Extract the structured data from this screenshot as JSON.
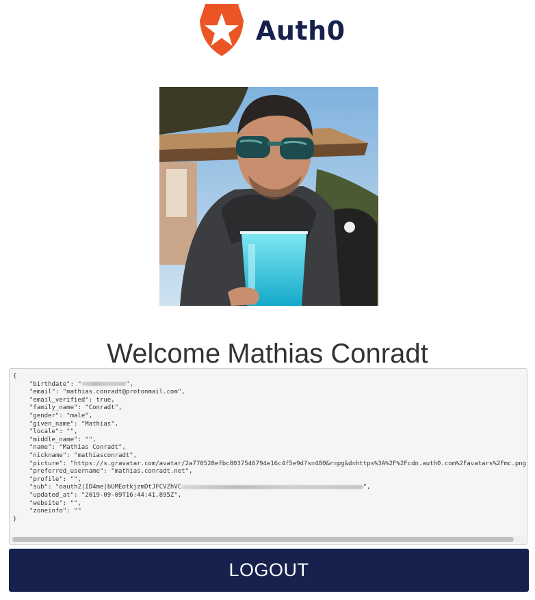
{
  "brand": {
    "name": "Auth0",
    "accent_color": "#eb5424",
    "text_color": "#16214d",
    "logo_icon": "auth0-shield-star-icon"
  },
  "avatar": {
    "alt": "Profile picture of Mathias Conradt"
  },
  "welcome": {
    "greeting": "Welcome",
    "name": "Mathias Conradt"
  },
  "profile_json": {
    "open_brace": "{",
    "close_brace": "}",
    "fields": [
      {
        "key": "\"birthdate\": ",
        "value": "\"",
        "redacted_chars": 12,
        "suffix": "\","
      },
      {
        "key": "\"email\": ",
        "value": "\"mathias.conradt@protonmail.com\",",
        "redacted_chars": 0,
        "suffix": ""
      },
      {
        "key": "\"email_verified\": ",
        "value": "true,",
        "redacted_chars": 0,
        "suffix": ""
      },
      {
        "key": "\"family_name\": ",
        "value": "\"Conradt\",",
        "redacted_chars": 0,
        "suffix": ""
      },
      {
        "key": "\"gender\": ",
        "value": "\"male\",",
        "redacted_chars": 0,
        "suffix": ""
      },
      {
        "key": "\"given_name\": ",
        "value": "\"Mathias\",",
        "redacted_chars": 0,
        "suffix": ""
      },
      {
        "key": "\"locale\": ",
        "value": "\"\",",
        "redacted_chars": 0,
        "suffix": ""
      },
      {
        "key": "\"middle_name\": ",
        "value": "\"\",",
        "redacted_chars": 0,
        "suffix": ""
      },
      {
        "key": "\"name\": ",
        "value": "\"Mathias Conradt\",",
        "redacted_chars": 0,
        "suffix": ""
      },
      {
        "key": "\"nickname\": ",
        "value": "\"mathiasconradt\",",
        "redacted_chars": 0,
        "suffix": ""
      },
      {
        "key": "\"picture\": ",
        "value": "\"https://s.gravatar.com/avatar/2a770528efbc8037546794e16c4f5e9d?s=480&r=pg&d=https%3A%2F%2Fcdn.auth0.com%2Favatars%2Fmc.png\"",
        "redacted_chars": 0,
        "suffix": ""
      },
      {
        "key": "\"preferred_username\": ",
        "value": "\"mathias.conradt.net\",",
        "redacted_chars": 0,
        "suffix": ""
      },
      {
        "key": "\"profile\": ",
        "value": "\"\",",
        "redacted_chars": 0,
        "suffix": ""
      },
      {
        "key": "\"sub\": ",
        "value": "\"oauth2|ID4me|bUMEotkjzmDtJFCVZhVC",
        "redacted_chars": 49,
        "suffix": "\","
      },
      {
        "key": "\"updated_at\": ",
        "value": "\"2019-09-09T16:44:41.895Z\",",
        "redacted_chars": 0,
        "suffix": ""
      },
      {
        "key": "\"website\": ",
        "value": "\"\",",
        "redacted_chars": 0,
        "suffix": ""
      },
      {
        "key": "\"zoneinfo\": ",
        "value": "\"\"",
        "redacted_chars": 0,
        "suffix": ""
      }
    ]
  },
  "scrollbar": {
    "visible_fraction": 0.98
  },
  "logout": {
    "label": "LOGOUT",
    "bg_color": "#16214d"
  }
}
